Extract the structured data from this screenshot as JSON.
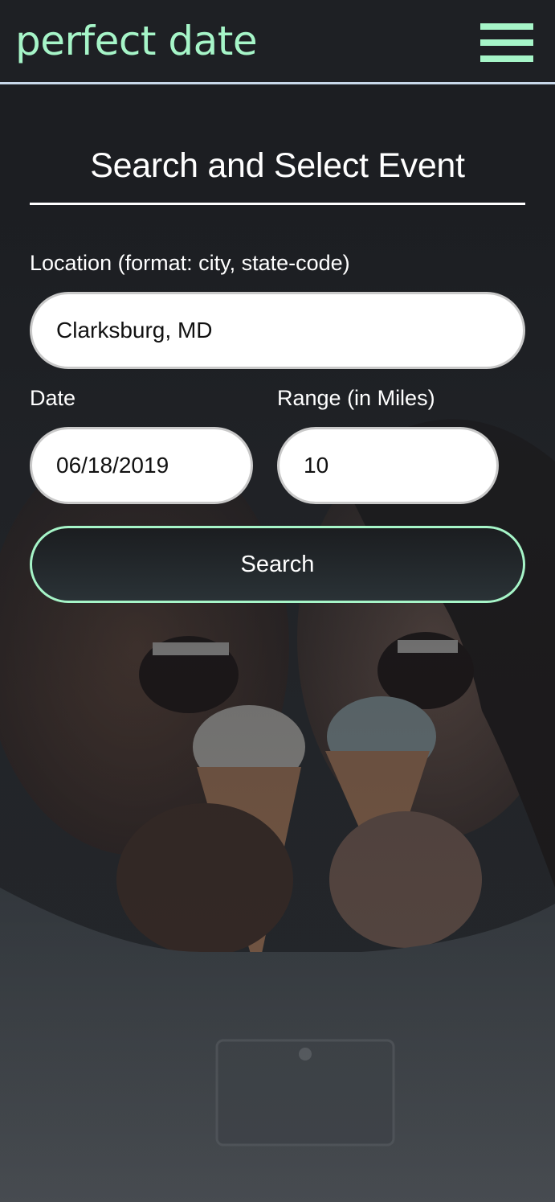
{
  "header": {
    "brand": "perfect date",
    "menu_icon": "hamburger-menu-icon"
  },
  "form": {
    "title": "Search and Select Event",
    "location": {
      "label": "Location (format: city, state-code)",
      "value": "Clarksburg, MD"
    },
    "date": {
      "label": "Date",
      "value": "06/18/2019"
    },
    "range": {
      "label": "Range (in Miles)",
      "value": "10"
    },
    "search_button": "Search"
  },
  "colors": {
    "accent": "#a6f5c8",
    "header_bg": "#1e2024",
    "header_border": "#c8d8ea",
    "text": "#ffffff"
  }
}
